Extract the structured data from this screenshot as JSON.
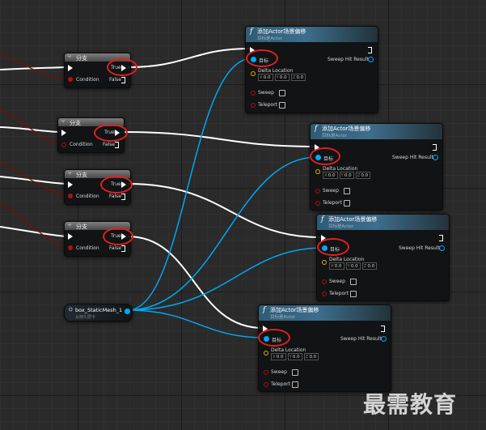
{
  "branch_nodes": [
    {
      "title": "分支",
      "out_true": "True",
      "out_false": "False",
      "in_condition": "Condition"
    },
    {
      "title": "分支",
      "out_true": "True",
      "out_false": "False",
      "in_condition": "Condition"
    },
    {
      "title": "分支",
      "out_true": "True",
      "out_false": "False",
      "in_condition": "Condition"
    },
    {
      "title": "分支",
      "out_true": "True",
      "out_false": "False",
      "in_condition": "Condition"
    }
  ],
  "add_nodes": [
    {
      "title": "添加Actor场景偏移",
      "subtitle": "目标是Actor",
      "target": "目标",
      "delta_location": "Delta Location",
      "x": "0.0",
      "y": "0.0",
      "z": "0.0",
      "sweep": "Sweep",
      "teleport": "Teleport",
      "sweep_hit": "Sweep Hit Result"
    },
    {
      "title": "添加Actor场景偏移",
      "subtitle": "目标是Actor",
      "target": "目标",
      "delta_location": "Delta Location",
      "x": "0.0",
      "y": "0.0",
      "z": "0.0",
      "sweep": "Sweep",
      "teleport": "Teleport",
      "sweep_hit": "Sweep Hit Result"
    },
    {
      "title": "添加Actor场景偏移",
      "subtitle": "目标是Actor",
      "target": "目标",
      "delta_location": "Delta Location",
      "x": "0.0",
      "y": "0.0",
      "z": "0.0",
      "sweep": "Sweep",
      "teleport": "Teleport",
      "sweep_hit": "Sweep Hit Result"
    },
    {
      "title": "添加Actor场景偏移",
      "subtitle": "目标是Actor",
      "target": "目标",
      "delta_location": "Delta Location",
      "x": "0.0",
      "y": "0.0",
      "z": "0.0",
      "sweep": "Sweep",
      "teleport": "Teleport",
      "sweep_hit": "Sweep Hit Result"
    }
  ],
  "axis": {
    "x": "X",
    "y": "Y",
    "z": "Z"
  },
  "variable_node": {
    "name": "box_StaticMesh_1",
    "subtitle": "从持久层卡"
  },
  "watermark": "最需教育",
  "colors": {
    "exec_wire": "#ffffff",
    "object_wire": "#00a8f4",
    "bool_wire": "#8b0000",
    "highlight": "#e61f1f",
    "header_blue": "#3d6e8c",
    "header_gray": "#6e6e6e"
  }
}
